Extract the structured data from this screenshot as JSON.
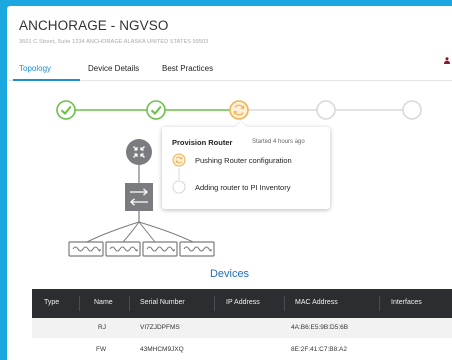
{
  "site": {
    "title": "ANCHORAGE - NGVSO",
    "address": "3601 C Street, Suite 1234 ANCHORAGE ALASKA UNITED STATES 99503"
  },
  "tabs": [
    {
      "label": "Topology",
      "active": true
    },
    {
      "label": "Device Details",
      "active": false
    },
    {
      "label": "Best Practices",
      "active": false
    }
  ],
  "stepper": {
    "steps": [
      {
        "status": "complete"
      },
      {
        "status": "complete"
      },
      {
        "status": "in-progress"
      },
      {
        "status": "pending"
      },
      {
        "status": "pending"
      }
    ],
    "colors": {
      "complete": "#6cc04a",
      "in_progress": "#f4b350",
      "pending": "#d8d8d8"
    }
  },
  "popover": {
    "title": "Provision Router",
    "time": "Started 4 hours ago",
    "steps": [
      {
        "label": "Pushing Router configuration",
        "status": "in-progress"
      },
      {
        "label": "Adding router to PI Inventory",
        "status": "pending"
      }
    ]
  },
  "devices": {
    "title": "Devices",
    "columns": [
      "Type",
      "Name",
      "Serial Number",
      "IP Address",
      "MAC Address",
      "Interfaces"
    ],
    "rows": [
      {
        "type": "",
        "name": "RJ",
        "serial": "VI7ZJDPFMS",
        "ip": "",
        "mac": "4A:B6:E5:9B:D5:6B",
        "interfaces": ""
      },
      {
        "type": "",
        "name": "FW",
        "serial": "43MHCM9JXQ",
        "ip": "",
        "mac": "8E:2F:41:C7:B8:A2",
        "interfaces": ""
      }
    ]
  },
  "colors": {
    "accent": "#1f8fd4",
    "background": "#1ba8e0",
    "header_dark": "#2b2d31"
  }
}
